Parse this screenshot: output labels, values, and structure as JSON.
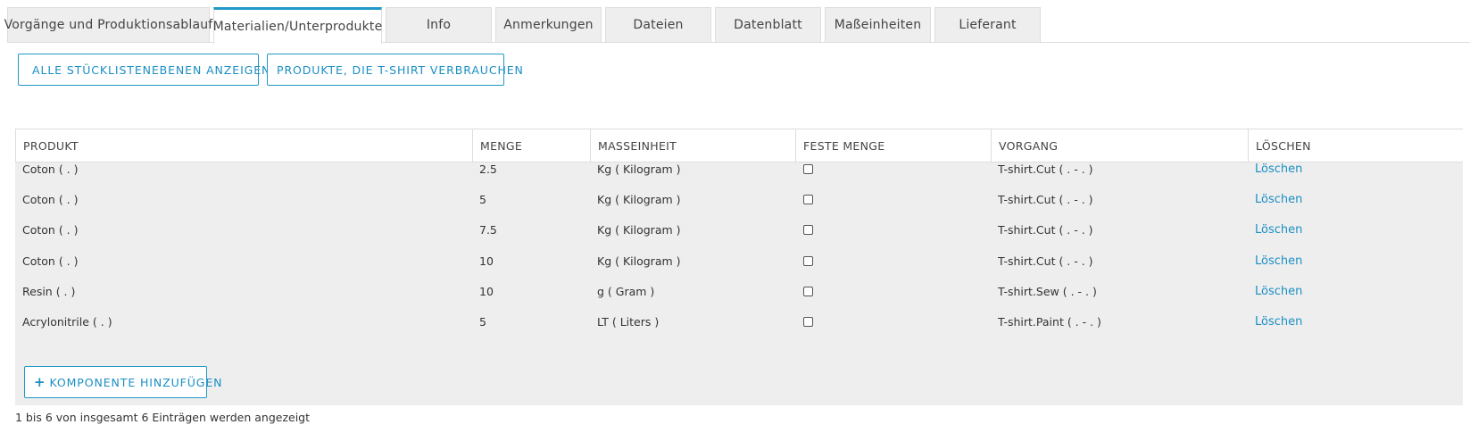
{
  "tabs": [
    {
      "label": "Vorgänge und Produktionsablauf",
      "active": false
    },
    {
      "label": "Materialien/Unterprodukte",
      "active": true
    },
    {
      "label": "Info",
      "active": false
    },
    {
      "label": "Anmerkungen",
      "active": false
    },
    {
      "label": "Dateien",
      "active": false
    },
    {
      "label": "Datenblatt",
      "active": false
    },
    {
      "label": "Maßeinheiten",
      "active": false
    },
    {
      "label": "Lieferant",
      "active": false
    }
  ],
  "actions": {
    "show_bom_levels_label": "ALLE STÜCKLISTENEBENEN ANZEIGEN",
    "products_consuming_label": "PRODUKTE, DIE T-SHIRT VERBRAUCHEN",
    "add_component_label": "KOMPONENTE HINZUFÜGEN"
  },
  "table": {
    "headers": {
      "product": "PRODUKT",
      "quantity": "MENGE",
      "unit": "MASSEINHEIT",
      "fixed_quantity": "FESTE MENGE",
      "operation": "VORGANG",
      "delete": "LÖSCHEN"
    },
    "rows": [
      {
        "product": "Coton ( . )",
        "quantity": "2.5",
        "unit": "Kg ( Kilogram )",
        "fixed": false,
        "operation": "T-shirt.Cut ( . - . )",
        "delete": "Löschen"
      },
      {
        "product": "Coton ( . )",
        "quantity": "5",
        "unit": "Kg ( Kilogram )",
        "fixed": false,
        "operation": "T-shirt.Cut ( . - . )",
        "delete": "Löschen"
      },
      {
        "product": "Coton ( . )",
        "quantity": "7.5",
        "unit": "Kg ( Kilogram )",
        "fixed": false,
        "operation": "T-shirt.Cut ( . - . )",
        "delete": "Löschen"
      },
      {
        "product": "Coton ( . )",
        "quantity": "10",
        "unit": "Kg ( Kilogram )",
        "fixed": false,
        "operation": "T-shirt.Cut ( . - . )",
        "delete": "Löschen"
      },
      {
        "product": "Resin ( . )",
        "quantity": "10",
        "unit": "g ( Gram )",
        "fixed": false,
        "operation": "T-shirt.Sew ( . - . )",
        "delete": "Löschen"
      },
      {
        "product": "Acrylonitrile ( . )",
        "quantity": "5",
        "unit": "LT ( Liters )",
        "fixed": false,
        "operation": "T-shirt.Paint ( . - . )",
        "delete": "Löschen"
      }
    ]
  },
  "footer": {
    "info": "1 bis 6 von insgesamt 6 Einträgen werden angezeigt"
  },
  "colors": {
    "accent": "#2199c8",
    "link": "#1a8fc4",
    "table_bg": "#eeeeee",
    "tab_bg": "#eeeeee"
  }
}
